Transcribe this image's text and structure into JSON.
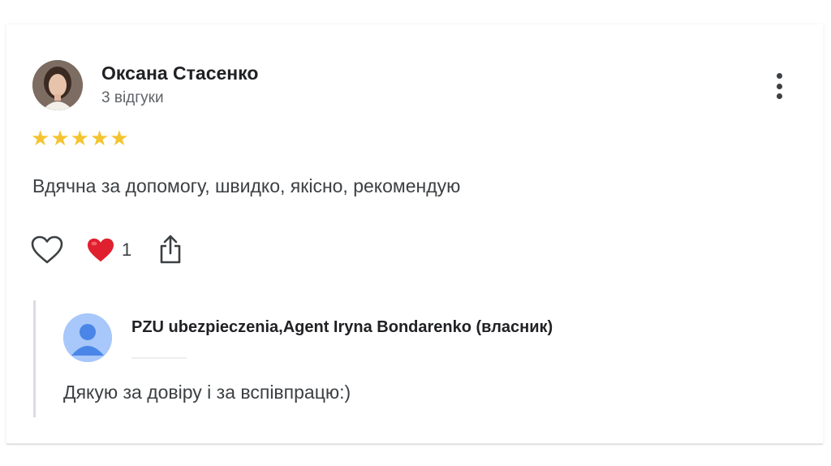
{
  "review": {
    "author_name": "Оксана Стасенко",
    "author_reviews": "3 відгуки",
    "rating": 5,
    "rating_max": 5,
    "star_glyph": "★",
    "text": "Вдячна за допомогу, швидко, якісно, рекомендую",
    "reaction_count": "1",
    "star_color": "#f4c430"
  },
  "icons": {
    "more": "more-vert-icon",
    "like": "heart-outline-icon",
    "reaction": "red-heart-emoji-icon",
    "share": "share-icon"
  },
  "owner_reply": {
    "name": "PZU ubezpieczenia,Agent Iryna Bondarenko (власник)",
    "text": "Дякую за довіру і за вспівпрацю:)",
    "avatar_color": "#a8c7fa"
  }
}
